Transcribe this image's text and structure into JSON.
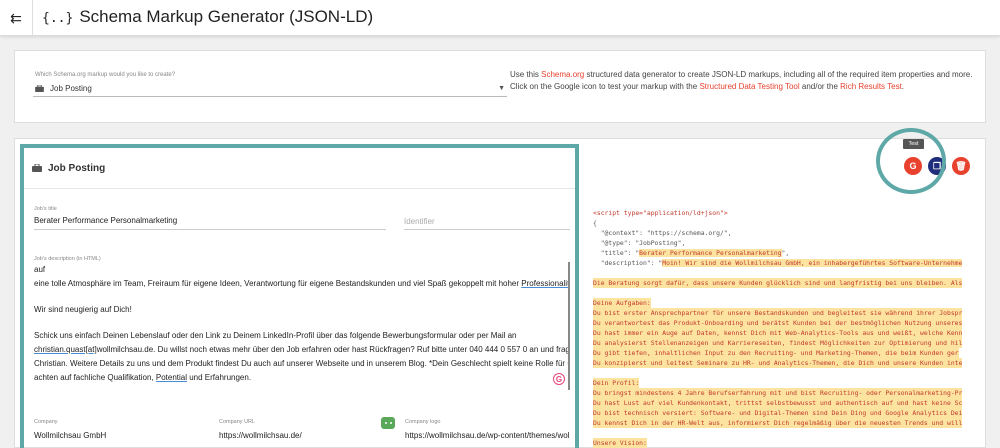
{
  "header": {
    "title": "Schema Markup Generator (JSON-LD)",
    "title_icon": "{..}"
  },
  "selector": {
    "label": "Which Schema.org markup would you like to create?",
    "value": "Job Posting"
  },
  "description": {
    "p1": "Use this ",
    "p1_link": "Schema.org",
    "p2": " structured data generator to create JSON-LD markups, including all of the required item properties and more. Click on the Google icon to test your markup with the ",
    "p2_link": "Structured Data Testing Tool",
    "p3": " and/or the ",
    "p3_link": "Rich Results Test",
    "p4": "."
  },
  "form": {
    "heading": "Job Posting",
    "job_title_label": "Job's title",
    "job_title_value": "Berater Performance Personalmarketing",
    "identifier_placeholder": "Identifier",
    "job_desc_label": "Job's description (in HTML)",
    "job_desc": {
      "l1": "auf",
      "l2a": "eine tolle Atmosphäre im Team, Freiraum für eigene Ideen, Verantwortung für eigene Bestandskunden und viel Spaß gekoppelt mit hoher ",
      "l2b": "Professionalität",
      "l3": "Wir sind neugierig auf Dich!",
      "l4": "Schick uns einfach Deinen Lebenslauf oder den Link zu Deinem LinkedIn-Profil über das folgende Bewerbungsformular oder per Mail an",
      "l5a": "christian.quast[at]",
      "l5b": "wollmilchsau.de. Du willst noch etwas mehr über den Job erfahren oder hast Rückfragen? Ruf bitte unter 040 444 0 557 0 an und frag nach",
      "l6": "Christian. Weitere Details zu uns und dem Produkt findest Du auch auf unserer Webseite und in unserem Blog. *Dein Geschlecht spielt keine Rolle für uns, wir",
      "l7a": "achten auf fachliche Qualifikation, ",
      "l7b": "Potential",
      "l7c": " und Erfahrungen."
    },
    "company_label": "Company",
    "company_value": "Wollmilchsau GmbH",
    "company_url_label": "Company URL",
    "company_url_value": "https://wollmilchsau.de/",
    "company_logo_label": "Company logo",
    "company_logo_value": "https://wollmilchsau.de/wp-content/themes/woll"
  },
  "code": {
    "l1_open": "<script type=\"application/ld+json\">",
    "l2": "{",
    "l3": "  \"@context\": \"https://schema.org/\",",
    "l4": "  \"@type\": \"JobPosting\",",
    "l5a": "  \"title\": \"",
    "l5b": "Berater Performance Personalmarketing",
    "l5c": "\",",
    "l6a": "  \"description\": \"",
    "l6b": "Moin! Wir sind die Wollmilchsau GmbH, ein inhabergeführtes Software-Unternehme",
    "l7": "Die Beratung sorgt dafür, dass unsere Kunden glücklich sind und langfristig bei uns bleiben. Als",
    "l8": "Deine Aufgaben:",
    "l9": "Du bist erster Ansprechpartner für unsere Bestandskunden und begleitest sie während ihrer Jobspr",
    "l10": "Du verantwortest das Produkt-Onboarding und berätst Kunden bei der bestmöglichen Nutzung unseres",
    "l11": "Du hast immer ein Auge auf Daten, kennst Dich mit Web-Analytics-Tools aus und weißt, welche Kenn",
    "l12": "Du analysierst Stellenanzeigen und Karriereseiten, findest Möglichkeiten zur Optimierung und hil",
    "l13": "Du gibt tiefen, inhaltlichen Input zu den Recruiting- und Marketing-Themen, die beim Kunden ger",
    "l14": "Du konzipierst und leitest Seminare zu HR- und Analytics-Themen, die Dich und unsere Kunden inte",
    "l15": "Dein Profil:",
    "l16": "Du bringst mindestens 4 Jahre Berufserfahrung mit und bist Recruiting- oder Personalmarketing-Pr",
    "l17": "Du hast Lust auf viel Kundenkontakt, trittst selbstbewusst und authentisch auf und hast keine Sc",
    "l18": "Du bist technisch versiert: Software- und Digital-Themen sind Dein Ding und Google Analytics Dei",
    "l19": "Du kennst Dich in der HR-Welt aus, informierst Dich regelmäßig über die neuesten Trends und will",
    "l20": "Unsere Vision:"
  },
  "actions": {
    "tooltip": "Test",
    "google_glyph": "G",
    "copy_glyph": "❐",
    "delete_glyph": "🗑"
  },
  "menu_glyph": "⇇",
  "grammar_glyph": "G",
  "colors": {
    "accent": "#e8412e",
    "annotation": "#5fa8a8",
    "highlight": "#fde3a0",
    "copy_button": "#1f2d7a"
  }
}
